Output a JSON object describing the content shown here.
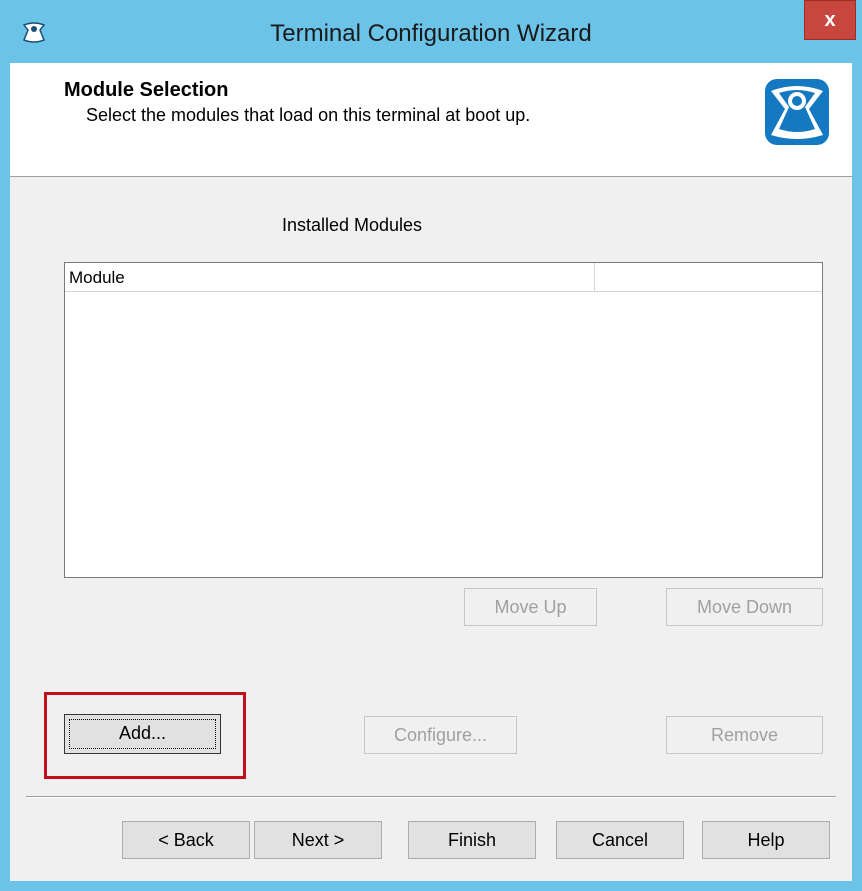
{
  "window": {
    "title": "Terminal Configuration Wizard",
    "close_label": "x"
  },
  "header": {
    "title": "Module Selection",
    "subtitle": "Select the modules that load on this terminal at boot up."
  },
  "modules": {
    "label": "Installed Modules",
    "columns": [
      "Module",
      ""
    ],
    "rows": []
  },
  "buttons": {
    "move_up": "Move Up",
    "move_down": "Move Down",
    "add": "Add...",
    "configure": "Configure...",
    "remove": "Remove"
  },
  "footer": {
    "back": "< Back",
    "next": "Next >",
    "finish": "Finish",
    "cancel": "Cancel",
    "help": "Help"
  },
  "colors": {
    "titlebar": "#6cc3e8",
    "close": "#c7473f",
    "highlight": "#c0111b",
    "logo": "#1479c0"
  }
}
